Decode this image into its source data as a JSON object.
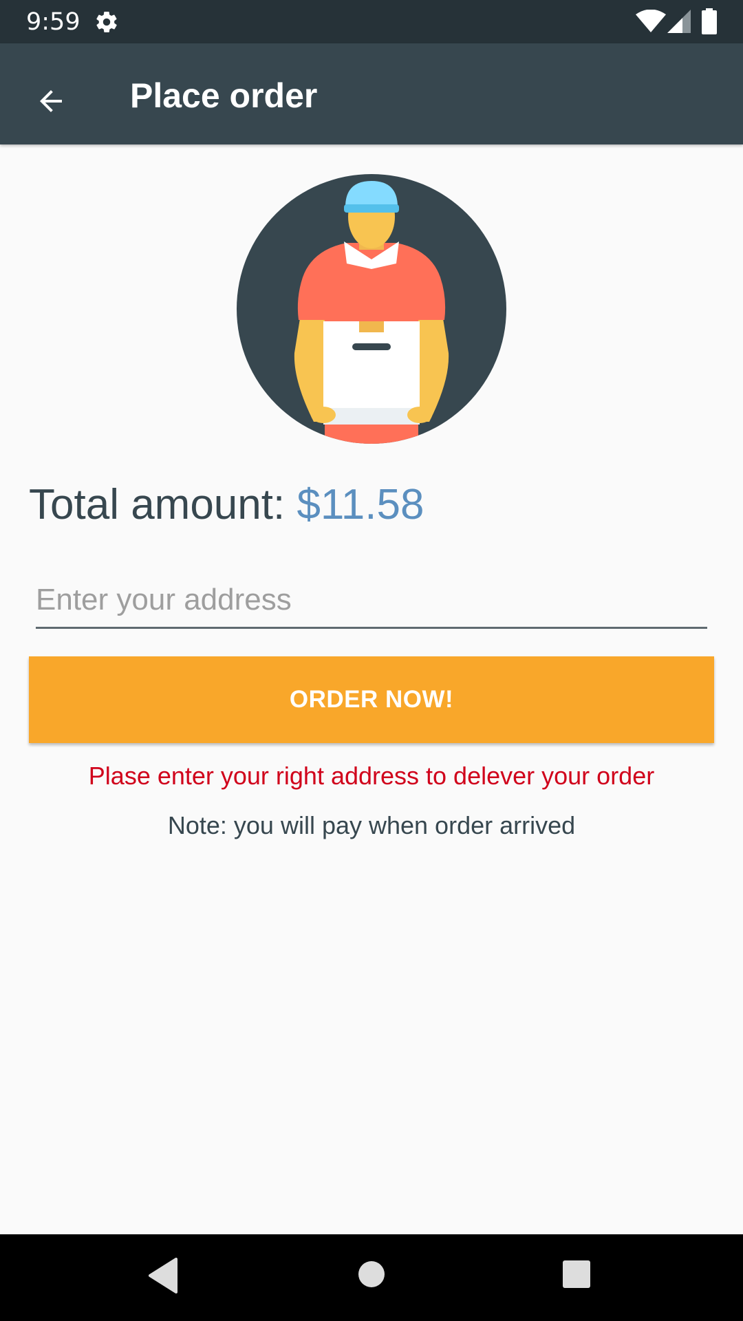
{
  "status_bar": {
    "time": "9:59",
    "icons": [
      "gear-icon",
      "wifi-icon",
      "signal-icon",
      "battery-icon"
    ]
  },
  "toolbar": {
    "title": "Place order",
    "back_icon": "arrow-back-icon"
  },
  "illustration": {
    "icon": "delivery-man-icon"
  },
  "total": {
    "label": "Total amount: ",
    "value": "$11.58"
  },
  "address": {
    "value": "",
    "placeholder": "Enter your address"
  },
  "order_button": {
    "label": "ORDER NOW!"
  },
  "messages": {
    "error": "Plase enter your right address to delever your order",
    "note": "Note: you will pay when order arrived"
  },
  "nav_bar": {
    "icons": [
      "nav-back-icon",
      "nav-home-icon",
      "nav-recents-icon"
    ]
  },
  "colors": {
    "status_bar": "#263238",
    "toolbar": "#37474f",
    "accent_price": "#5b8fbf",
    "button": "#f9a72a",
    "error": "#d0021b",
    "background": "#fafafa"
  }
}
